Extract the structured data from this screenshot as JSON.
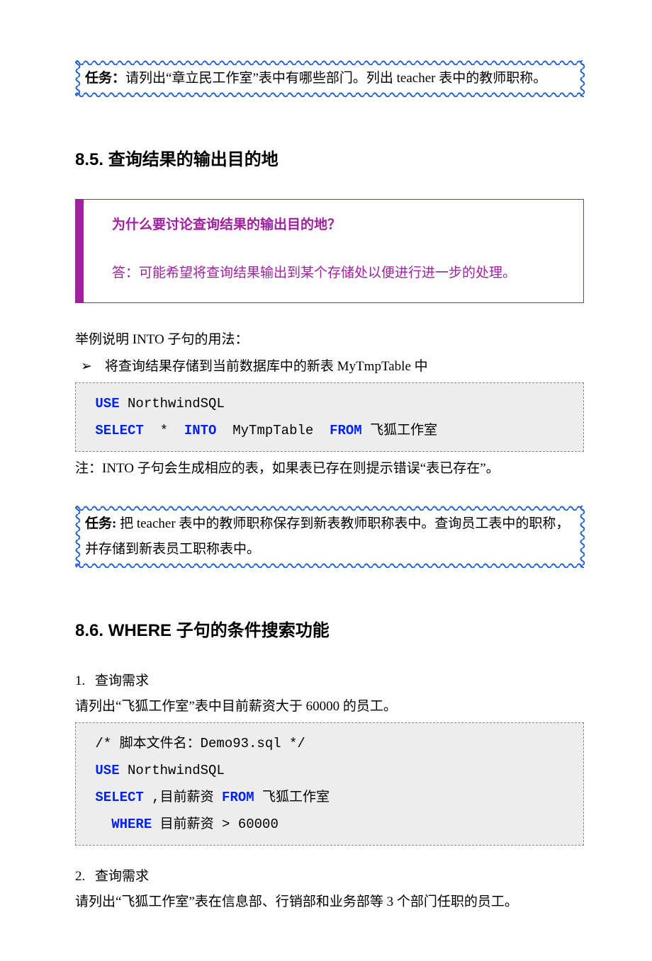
{
  "task1": {
    "label": "任务：",
    "text": "请列出“章立民工作室”表中有哪些部门。列出 teacher 表中的教师职称。"
  },
  "section85": {
    "heading": "8.5. 查询结果的输出目的地",
    "qa": {
      "question": "为什么要讨论查询结果的输出目的地？",
      "answer": "答：可能希望将查询结果输出到某个存储处以便进行进一步的处理。"
    },
    "intro": "举例说明 INTO 子句的用法：",
    "bullet": "将查询结果存储到当前数据库中的新表 MyTmpTable 中",
    "code": {
      "l1a": "USE",
      "l1b": " NorthwindSQL",
      "l2a": "SELECT",
      "l2b": "  *  ",
      "l2c": "INTO",
      "l2d": "  MyTmpTable  ",
      "l2e": "FROM",
      "l2f": " 飞狐工作室"
    },
    "note": "注：INTO 子句会生成相应的表，如果表已存在则提示错误“表已存在”。"
  },
  "task2": {
    "label": "任务:",
    "text": " 把 teacher 表中的教师职称保存到新表教师职称表中。查询员工表中的职称，并存储到新表员工职称表中。"
  },
  "section86": {
    "heading": "8.6. WHERE 子句的条件搜索功能",
    "item1num": "1.",
    "item1label": "查询需求",
    "item1text": "请列出“飞狐工作室”表中目前薪资大于 60000 的员工。",
    "code": {
      "c1": "/* 脚本文件名：Demo93.sql */",
      "l2a": "USE",
      "l2b": " NorthwindSQL",
      "l3a": "SELECT",
      "l3b": " ,目前薪资 ",
      "l3c": "FROM",
      "l3d": " 飞狐工作室",
      "l4a": "  WHERE",
      "l4b": " 目前薪资 > 60000"
    },
    "item2num": "2.",
    "item2label": "查询需求",
    "item2text": "请列出“飞狐工作室”表在信息部、行销部和业务部等 3 个部门任职的员工。"
  }
}
